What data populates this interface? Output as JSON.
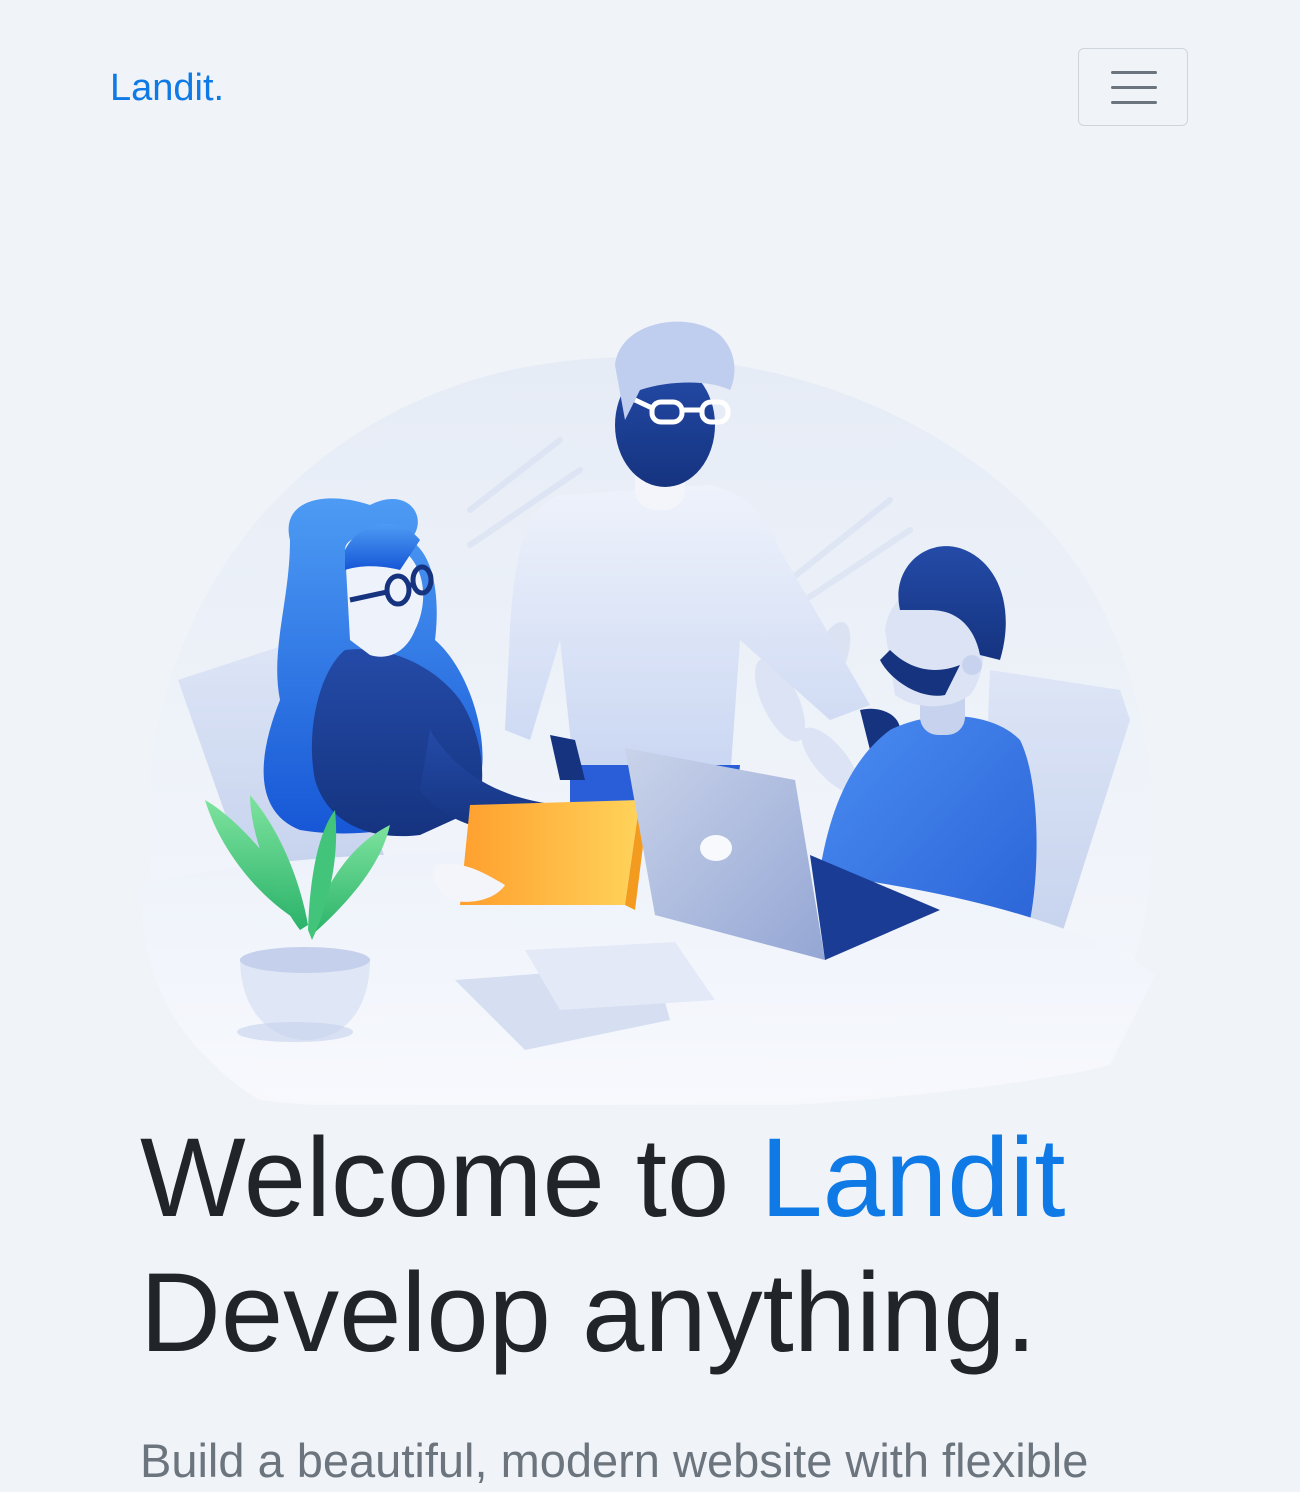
{
  "navbar": {
    "brand": "Landit.",
    "toggle_icon": "hamburger-menu-icon"
  },
  "hero": {
    "illustration": "team-meeting-illustration",
    "headline_part1": "Welcome to ",
    "headline_accent": "Landit",
    "headline_line2": "Develop anything.",
    "lead": "Build a beautiful, modern website with flexible"
  },
  "colors": {
    "accent": "#0f7ae5",
    "background": "#f0f4f9",
    "heading": "#212529",
    "muted": "#6c757d"
  }
}
